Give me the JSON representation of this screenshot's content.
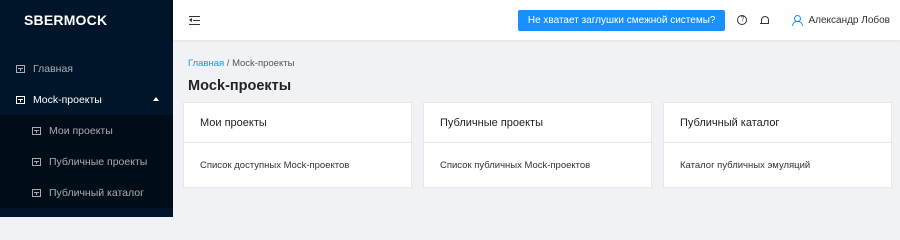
{
  "app": {
    "logo": "SBERMOCK"
  },
  "sidebar": {
    "items": [
      {
        "label": "Главная",
        "icon": "menu-page-icon"
      },
      {
        "label": "Mock-проекты",
        "icon": "menu-page-icon",
        "open": true,
        "children": [
          {
            "label": "Мои проекты",
            "icon": "menu-page-icon"
          },
          {
            "label": "Публичные проекты",
            "icon": "menu-page-icon"
          },
          {
            "label": "Публичный каталог",
            "icon": "menu-page-icon"
          }
        ]
      }
    ]
  },
  "header": {
    "stub_button": "Не хватает заглушки смежной системы?",
    "help_glyph": "?",
    "user_name": "Александр Лобов",
    "accent": "#1890ff"
  },
  "breadcrumb": {
    "home": "Главная",
    "separator": " / ",
    "current": "Mock-проекты"
  },
  "page": {
    "title": "Mock-проекты"
  },
  "cards": [
    {
      "title": "Мои проекты",
      "description": "Список доступных Mock-проектов"
    },
    {
      "title": "Публичные проекты",
      "description": "Список публичных Mock-проектов"
    },
    {
      "title": "Публичный каталог",
      "description": "Каталог публичных эмуляций"
    }
  ]
}
